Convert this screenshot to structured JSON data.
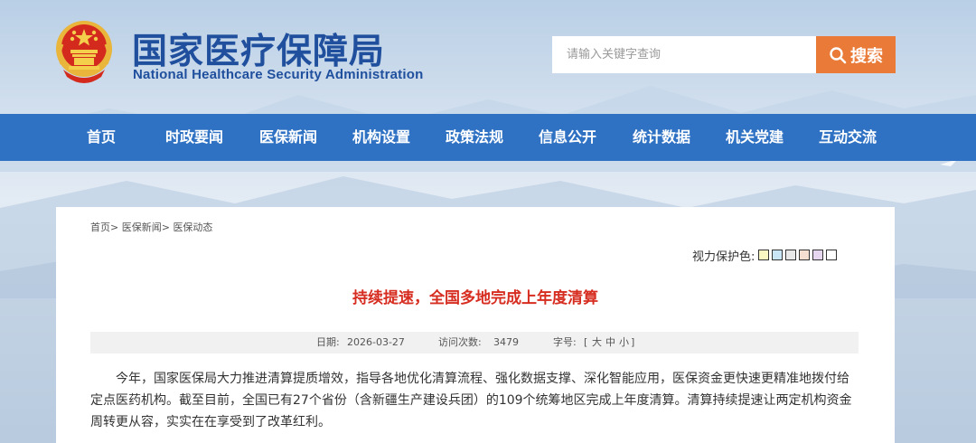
{
  "header": {
    "title_cn": "国家医疗保障局",
    "title_en": "National Healthcare Security Administration",
    "search_placeholder": "请输入关键字查询",
    "search_button_label": "搜索"
  },
  "nav": {
    "items": [
      "首页",
      "时政要闻",
      "医保新闻",
      "机构设置",
      "政策法规",
      "信息公开",
      "统计数据",
      "机关党建",
      "互动交流"
    ]
  },
  "breadcrumb": {
    "items": [
      "首页",
      "医保新闻",
      "医保动态"
    ],
    "separator": ">"
  },
  "vision": {
    "label": "视力保护色:",
    "swatches": [
      "#f9f7c2",
      "#c8e6f5",
      "#e8e8e8",
      "#f5dfd0",
      "#e6d6ef",
      "#ffffff"
    ]
  },
  "article": {
    "title": "持续提速，全国多地完成上年度清算",
    "date_label": "日期:",
    "date": "2026-03-27",
    "views_label": "访问次数:",
    "views": "3479",
    "fontsize_label": "字号:",
    "fontsize_open": "[",
    "fontsize_large": "大",
    "fontsize_medium": "中",
    "fontsize_small": "小",
    "fontsize_close": "]",
    "body": "今年，国家医保局大力推进清算提质增效，指导各地优化清算流程、强化数据支撑、深化智能应用，医保资金更快速更精准地拨付给定点医药机构。截至目前，全国已有27个省份（含新疆生产建设兵团）的109个统筹地区完成上年度清算。清算持续提速让两定机构资金周转更从容，实实在在享受到了改革红利。"
  },
  "colors": {
    "brand_blue": "#1f4f9d",
    "nav_blue": "#2f72c4",
    "search_orange": "#ea7a38",
    "title_red": "#d62d20"
  },
  "icons": {
    "emblem": "national-emblem",
    "search": "search-icon"
  }
}
